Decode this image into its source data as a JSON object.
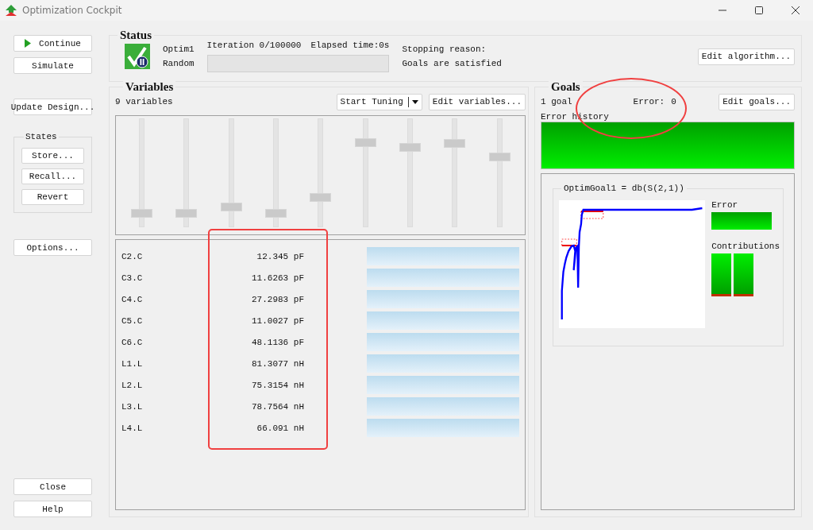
{
  "window": {
    "title": "Optimization Cockpit"
  },
  "side_buttons": [
    "Continue",
    "Simulate",
    "Update Design..."
  ],
  "states_group": {
    "title": "States",
    "buttons": [
      "Store...",
      "Recall...",
      "Revert"
    ]
  },
  "options_button": "Options...",
  "bottom_buttons": [
    "Close",
    "Help"
  ],
  "status": {
    "title": "Status",
    "optimizer": "Optim1",
    "method": "Random",
    "iteration": "Iteration 0/100000",
    "elapsed": "Elapsed time:0s",
    "stopping_label": "Stopping reason:",
    "stopping_reason": "Goals are satisfied",
    "progress": {
      "level": 0
    },
    "edit_button": "Edit algorithm..."
  },
  "variables": {
    "title": "Variables",
    "count": "9 variables",
    "tuning_button": "Start Tuning",
    "edit_button": "Edit variables...",
    "sliders": [
      {
        "level": 0.09
      },
      {
        "level": 0.09
      },
      {
        "level": 0.16
      },
      {
        "level": 0.09
      },
      {
        "level": 0.25
      },
      {
        "level": 0.79
      },
      {
        "level": 0.74
      },
      {
        "level": 0.78
      },
      {
        "level": 0.65
      }
    ],
    "rows": [
      {
        "name": "C2.C",
        "value": "12.345 pF"
      },
      {
        "name": "C3.C",
        "value": "11.6263 pF"
      },
      {
        "name": "C4.C",
        "value": "27.2983 pF"
      },
      {
        "name": "C5.C",
        "value": "11.0027 pF"
      },
      {
        "name": "C6.C",
        "value": "48.1136 pF"
      },
      {
        "name": "L1.L",
        "value": "81.3077 nH"
      },
      {
        "name": "L2.L",
        "value": "75.3154 nH"
      },
      {
        "name": "L3.L",
        "value": "78.7564 nH"
      },
      {
        "name": "L4.L",
        "value": "66.091 nH"
      }
    ]
  },
  "goals": {
    "title": "Goals",
    "count": "1 goal",
    "error_label": "Error:",
    "error_value": "0",
    "edit_button": "Edit goals...",
    "history_label": "Error history",
    "goal_title": "OptimGoal1 = db(S(2,1))",
    "error_caption": "Error",
    "contributions_caption": "Contributions"
  },
  "annotations": [
    {
      "kind": "ellipse"
    },
    {
      "kind": "rectangle"
    }
  ]
}
